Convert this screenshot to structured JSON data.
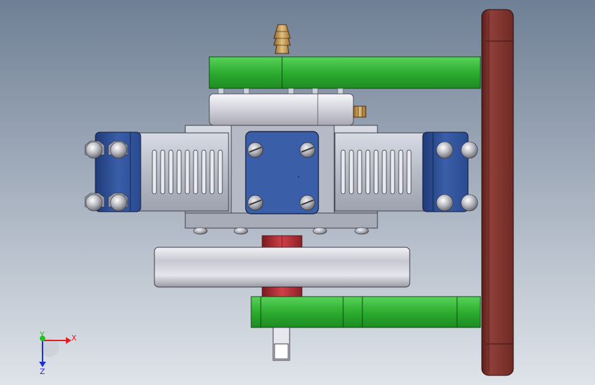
{
  "viewport": {
    "background_top": "#6f7f95",
    "background_bottom": "#dfe4ea"
  },
  "triad": {
    "x_label": "X",
    "y_label": "Y",
    "z_label": "Z",
    "x_color": "#e02020",
    "y_color": "#20c020",
    "z_color": "#2030d0"
  },
  "colors": {
    "mount_plate": "#8f3e38",
    "bracket_green": "#3cc040",
    "cylinder_blue": "#3a5ea8",
    "body_gray": "#c4c8d4",
    "shaft_red": "#c03038",
    "brass": "#c9a055"
  }
}
